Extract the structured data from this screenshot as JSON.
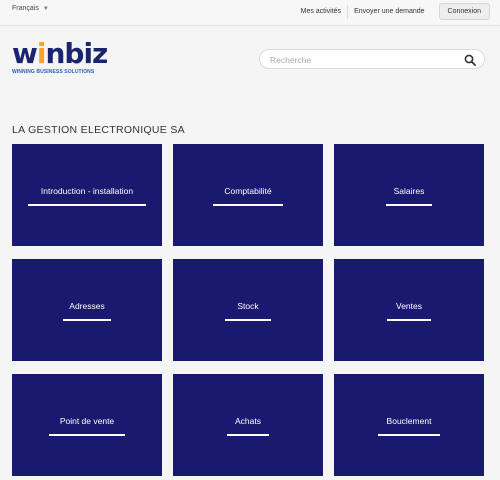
{
  "topbar": {
    "language": "Français",
    "links": [
      "Mes activités",
      "Envoyer une demande"
    ],
    "login_label": "Connexion"
  },
  "logo": {
    "text_w": "w",
    "text_i": "i",
    "text_rest": "nbiz",
    "tagline": "WINNING BUSINESS SOLUTIONS"
  },
  "search": {
    "placeholder": "Recherche",
    "icon": "search-icon"
  },
  "page_title": "LA GESTION ELECTRONIQUE SA",
  "categories": [
    {
      "label": "Introduction - installation"
    },
    {
      "label": "Comptabilité"
    },
    {
      "label": "Salaires"
    },
    {
      "label": "Adresses"
    },
    {
      "label": "Stock"
    },
    {
      "label": "Ventes"
    },
    {
      "label": "Point de vente"
    },
    {
      "label": "Achats"
    },
    {
      "label": "Bouclement"
    }
  ],
  "colors": {
    "tile_bg": "#19196f",
    "brand_blue": "#1a2470",
    "brand_orange": "#f5a623"
  }
}
